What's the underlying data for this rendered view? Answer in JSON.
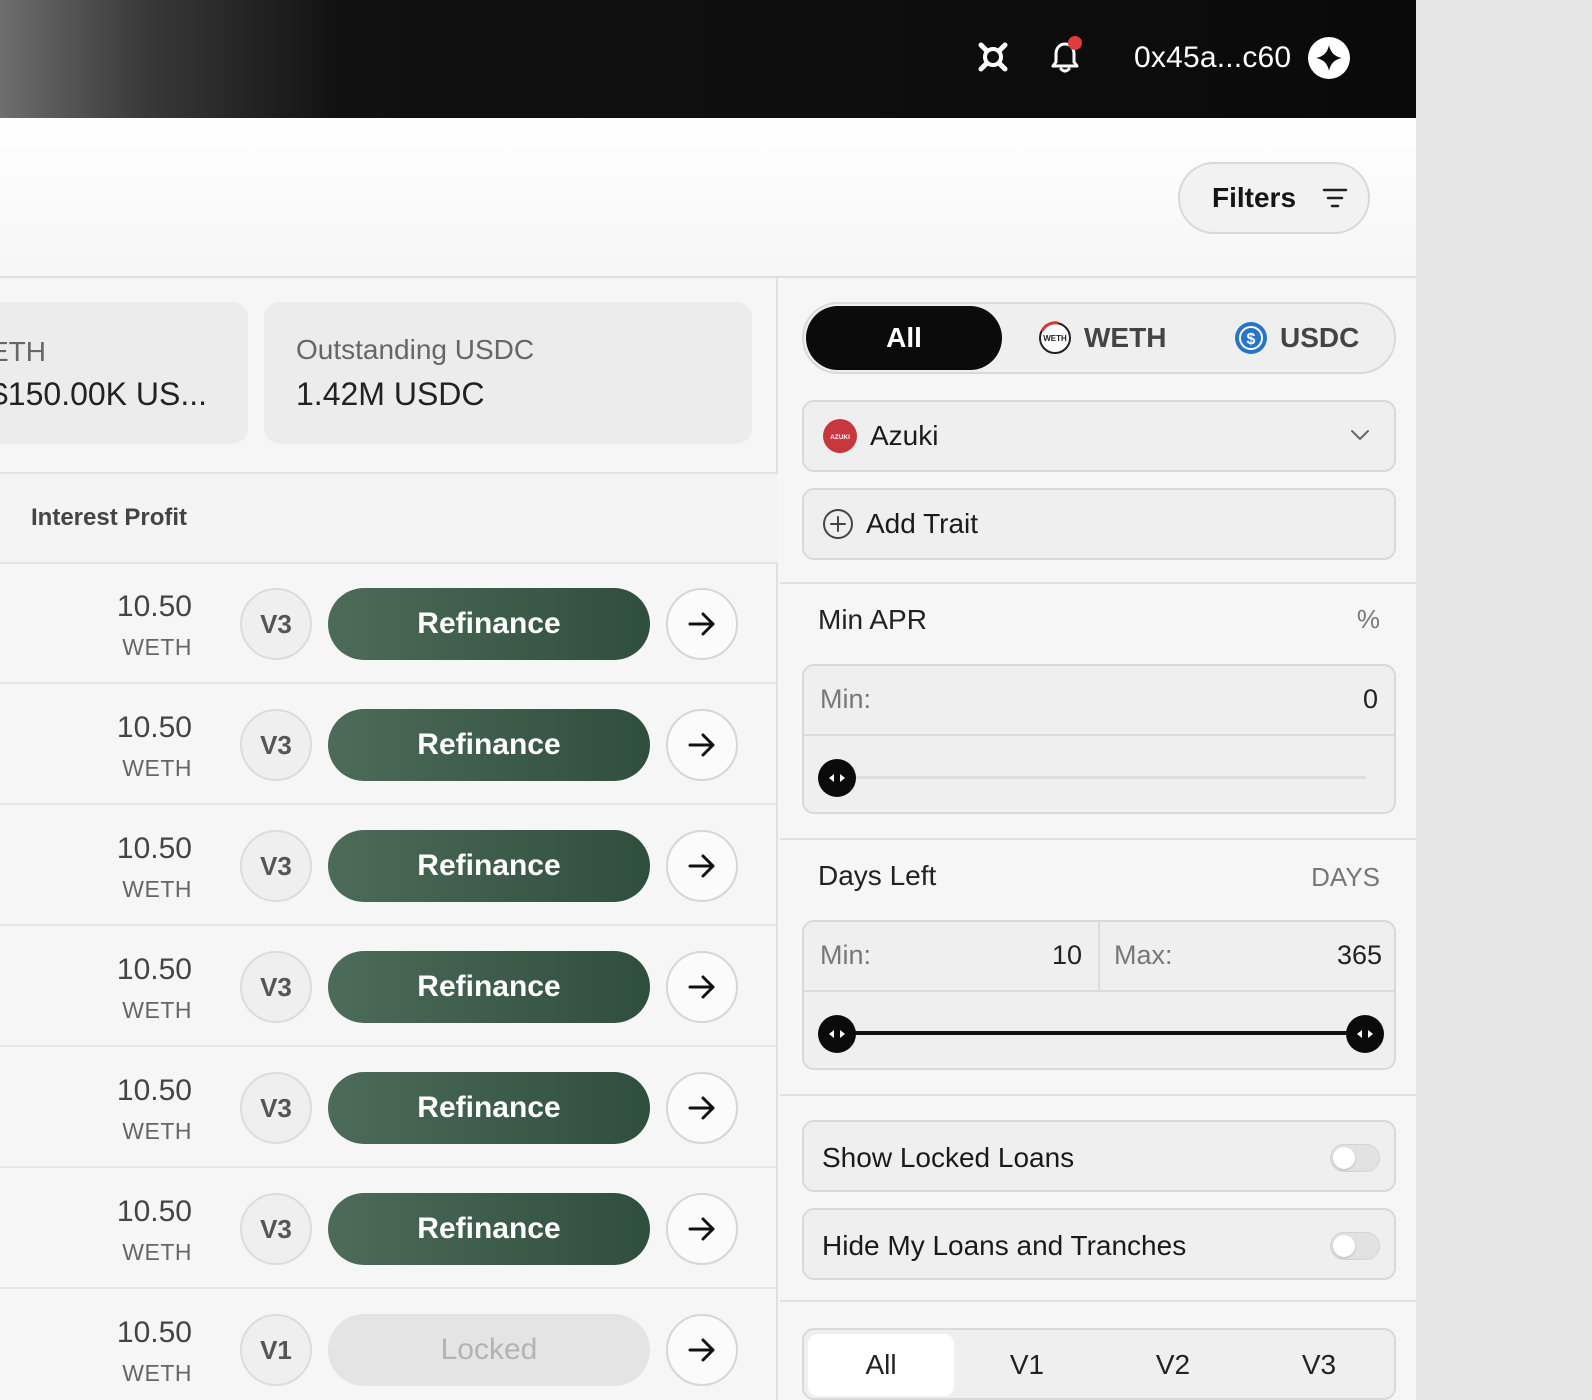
{
  "topbar": {
    "wallet_address": "0x45a...c60",
    "icons": [
      "settings-icon",
      "bell-icon",
      "wallet-avatar-icon"
    ]
  },
  "header": {
    "filters_label": "Filters"
  },
  "stats": [
    {
      "label": "ETH",
      "value": "$150.00K US..."
    },
    {
      "label": "Outstanding USDC",
      "value": "1.42M USDC"
    }
  ],
  "table": {
    "column_title": "Interest Profit",
    "rows": [
      {
        "amount": "10.50",
        "unit": "WETH",
        "version": "V3",
        "action": "Refinance",
        "locked": false
      },
      {
        "amount": "10.50",
        "unit": "WETH",
        "version": "V3",
        "action": "Refinance",
        "locked": false
      },
      {
        "amount": "10.50",
        "unit": "WETH",
        "version": "V3",
        "action": "Refinance",
        "locked": false
      },
      {
        "amount": "10.50",
        "unit": "WETH",
        "version": "V3",
        "action": "Refinance",
        "locked": false
      },
      {
        "amount": "10.50",
        "unit": "WETH",
        "version": "V3",
        "action": "Refinance",
        "locked": false
      },
      {
        "amount": "10.50",
        "unit": "WETH",
        "version": "V3",
        "action": "Refinance",
        "locked": false
      },
      {
        "amount": "10.50",
        "unit": "WETH",
        "version": "V1",
        "action": "Locked",
        "locked": true
      }
    ]
  },
  "filters_panel": {
    "currency_tabs": {
      "all": "All",
      "weth": "WETH",
      "usdc": "USDC",
      "selected": "All"
    },
    "collection": {
      "value": "Azuki",
      "logo_text": "AZUKI"
    },
    "add_trait": "Add Trait",
    "min_apr": {
      "title": "Min APR",
      "unit": "%",
      "min_label": "Min:",
      "min_value": "0",
      "slider_fraction": 0.0
    },
    "days_left": {
      "title": "Days Left",
      "unit": "DAYS",
      "min_label": "Min:",
      "min_value": "10",
      "max_label": "Max:",
      "max_value": "365"
    },
    "toggles": [
      {
        "label": "Show Locked Loans",
        "on": false
      },
      {
        "label": "Hide My Loans and Tranches",
        "on": false
      }
    ],
    "version_tabs": {
      "items": [
        "All",
        "V1",
        "V2",
        "V3"
      ],
      "selected": "All"
    }
  },
  "colors": {
    "refinance_button": "#3a5a48",
    "locked_button": "#e4e4e4",
    "notification_dot": "#e23b3b",
    "usdc_blue": "#2775ca",
    "azuki_red": "#c8373d"
  }
}
